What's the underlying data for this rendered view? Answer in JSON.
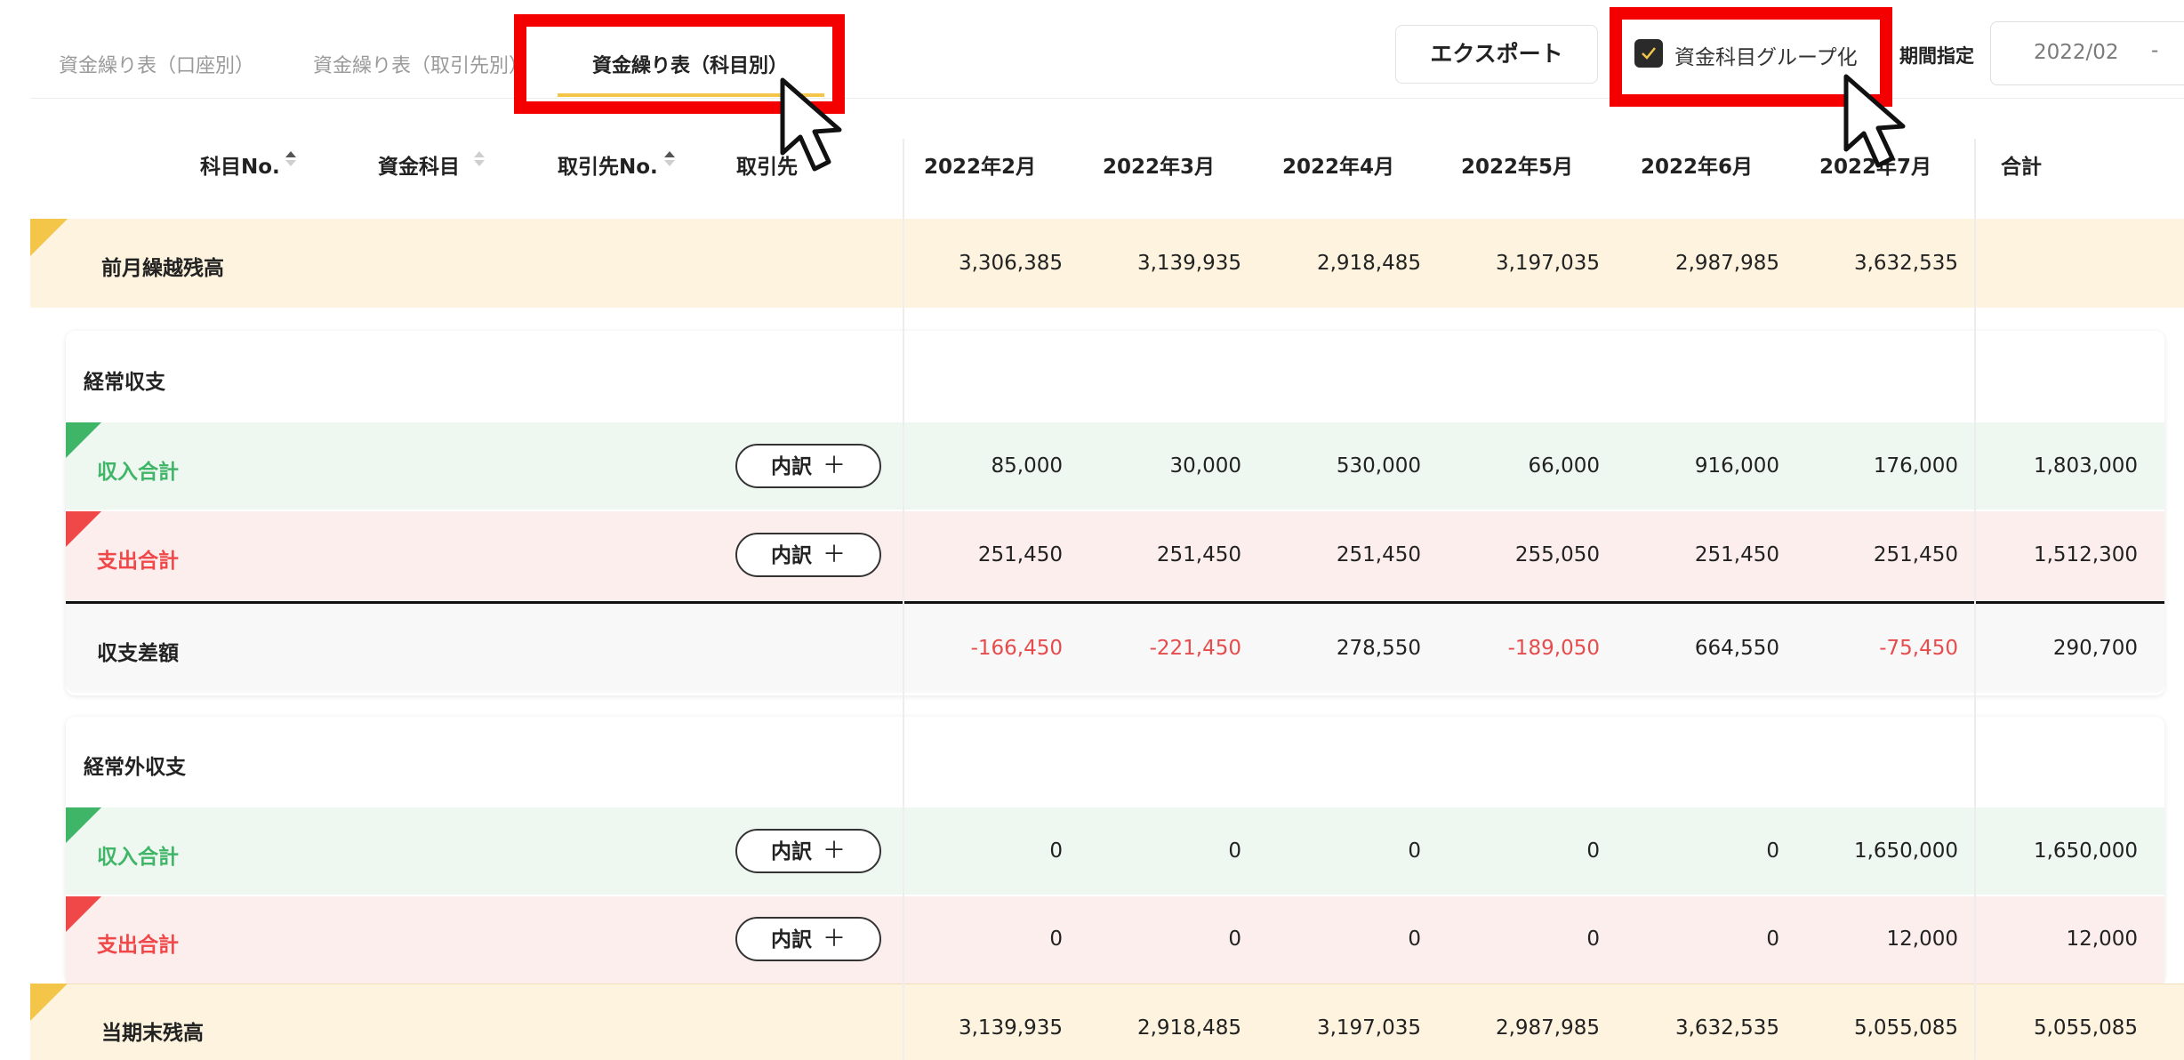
{
  "tabs": [
    {
      "label": "資金繰り表（口座別）",
      "active": false
    },
    {
      "label": "資金繰り表（取引先別）",
      "active": false
    },
    {
      "label": "資金繰り表（科目別）",
      "active": true
    }
  ],
  "toolbar": {
    "export_label": "エクスポート",
    "group_checkbox_label": "資金科目グループ化",
    "group_checked": true,
    "period_label": "期間指定",
    "period_start": "2022/02",
    "period_separator": "-"
  },
  "columns": {
    "account_no": "科目No.",
    "account": "資金科目",
    "partner_no": "取引先No.",
    "partner": "取引先",
    "months": [
      "2022年2月",
      "2022年3月",
      "2022年4月",
      "2022年5月",
      "2022年6月",
      "2022年7月"
    ],
    "total": "合計"
  },
  "breakdown_label": "内訳",
  "opening_balance": {
    "label": "前月繰越残高",
    "values": [
      "3,306,385",
      "3,139,935",
      "2,918,485",
      "3,197,035",
      "2,987,985",
      "3,632,535"
    ],
    "total": ""
  },
  "operating": {
    "title": "経常収支",
    "income": {
      "label": "収入合計",
      "values": [
        "85,000",
        "30,000",
        "530,000",
        "66,000",
        "916,000",
        "176,000"
      ],
      "total": "1,803,000"
    },
    "expense": {
      "label": "支出合計",
      "values": [
        "251,450",
        "251,450",
        "251,450",
        "255,050",
        "251,450",
        "251,450"
      ],
      "total": "1,512,300"
    },
    "difference": {
      "label": "収支差額",
      "values": [
        "-166,450",
        "-221,450",
        "278,550",
        "-189,050",
        "664,550",
        "-75,450"
      ],
      "total": "290,700"
    }
  },
  "non_operating": {
    "title": "経常外収支",
    "income": {
      "label": "収入合計",
      "values": [
        "0",
        "0",
        "0",
        "0",
        "0",
        "1,650,000"
      ],
      "total": "1,650,000"
    },
    "expense": {
      "label": "支出合計",
      "values": [
        "0",
        "0",
        "0",
        "0",
        "0",
        "12,000"
      ],
      "total": "12,000"
    }
  },
  "closing_balance": {
    "label": "当期末残高",
    "values": [
      "3,139,935",
      "2,918,485",
      "3,197,035",
      "2,987,985",
      "3,632,535",
      "5,055,085"
    ],
    "total": "5,055,085"
  },
  "colors": {
    "accent_yellow": "#f3c64a",
    "income_green": "#3fb567",
    "expense_red": "#f04848",
    "negative_red": "#e74c4c",
    "annotation_red": "#f50000"
  }
}
